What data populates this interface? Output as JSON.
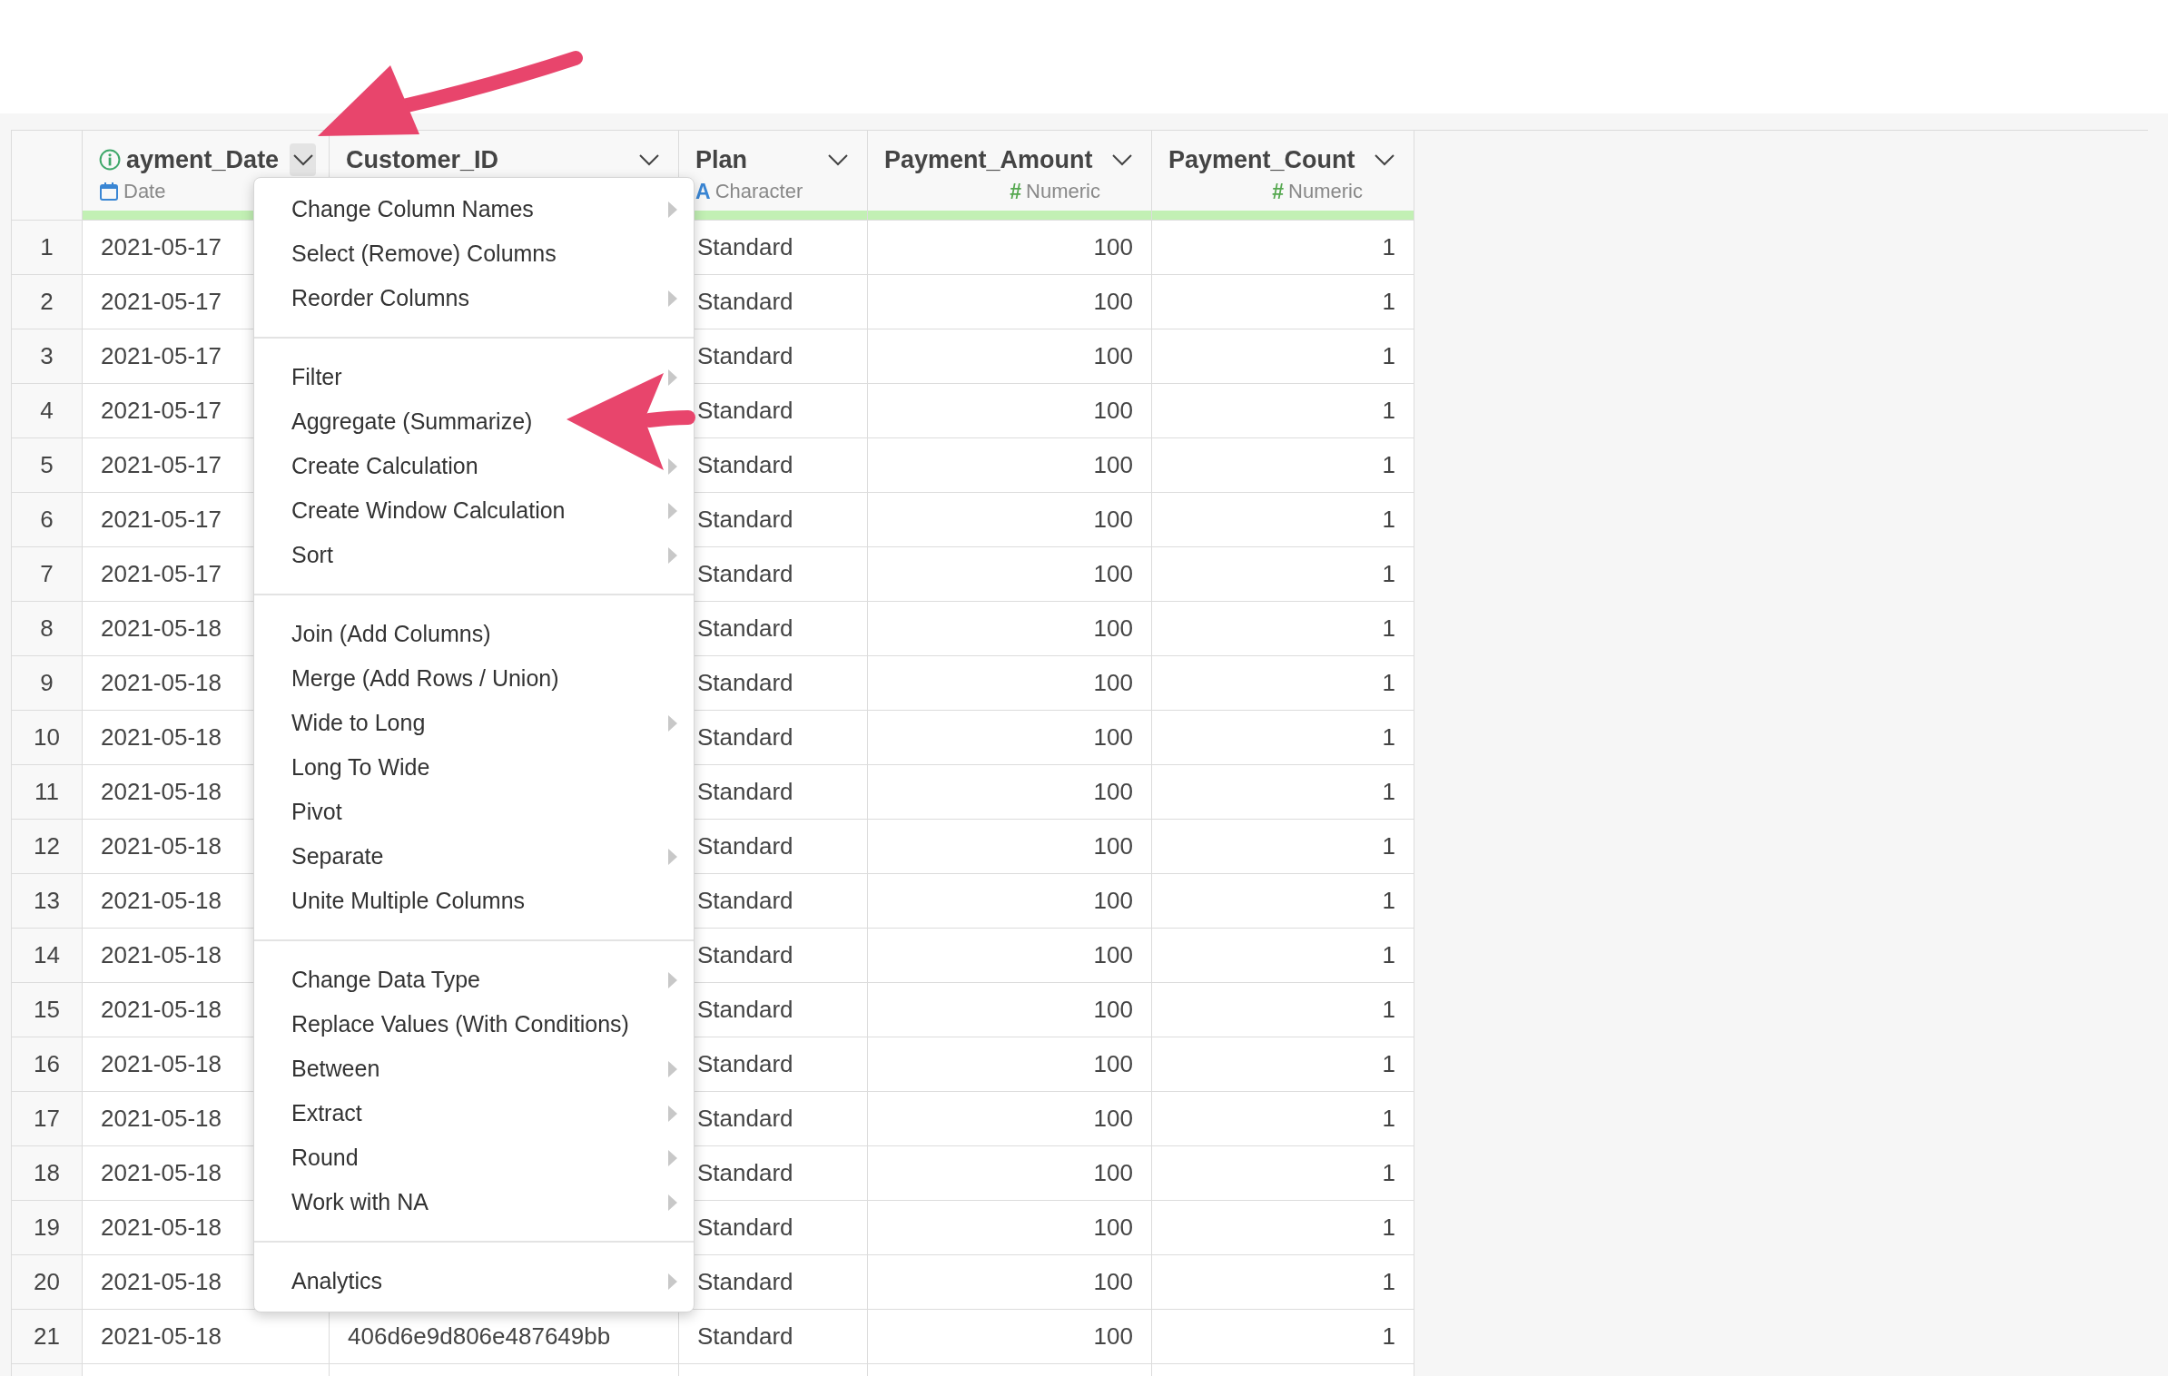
{
  "table": {
    "columns": [
      {
        "title": "ayment_Date",
        "info": true,
        "menu_open": true,
        "type": {
          "kind": "date",
          "label": "Date"
        }
      },
      {
        "title": "Customer_ID",
        "info": false,
        "menu_open": false
      },
      {
        "title": "Plan",
        "info": false,
        "menu_open": false,
        "type": {
          "kind": "character",
          "symbol": "A",
          "label": "Character"
        }
      },
      {
        "title": "Payment_Amount",
        "info": false,
        "menu_open": false,
        "type": {
          "kind": "numeric",
          "symbol": "#",
          "label": "Numeric"
        }
      },
      {
        "title": "Payment_Count",
        "info": false,
        "menu_open": false,
        "type": {
          "kind": "numeric",
          "symbol": "#",
          "label": "Numeric"
        }
      }
    ],
    "rows": [
      {
        "number": "1",
        "payment_date": "2021-05-17",
        "plan": "Standard",
        "payment_amount": "100",
        "payment_count": "1"
      },
      {
        "number": "2",
        "payment_date": "2021-05-17",
        "plan": "Standard",
        "payment_amount": "100",
        "payment_count": "1"
      },
      {
        "number": "3",
        "payment_date": "2021-05-17",
        "plan": "Standard",
        "payment_amount": "100",
        "payment_count": "1"
      },
      {
        "number": "4",
        "payment_date": "2021-05-17",
        "plan": "Standard",
        "payment_amount": "100",
        "payment_count": "1"
      },
      {
        "number": "5",
        "payment_date": "2021-05-17",
        "plan": "Standard",
        "payment_amount": "100",
        "payment_count": "1"
      },
      {
        "number": "6",
        "payment_date": "2021-05-17",
        "plan": "Standard",
        "payment_amount": "100",
        "payment_count": "1"
      },
      {
        "number": "7",
        "payment_date": "2021-05-17",
        "plan": "Standard",
        "payment_amount": "100",
        "payment_count": "1"
      },
      {
        "number": "8",
        "payment_date": "2021-05-18",
        "plan": "Standard",
        "payment_amount": "100",
        "payment_count": "1"
      },
      {
        "number": "9",
        "payment_date": "2021-05-18",
        "plan": "Standard",
        "payment_amount": "100",
        "payment_count": "1"
      },
      {
        "number": "10",
        "payment_date": "2021-05-18",
        "plan": "Standard",
        "payment_amount": "100",
        "payment_count": "1"
      },
      {
        "number": "11",
        "payment_date": "2021-05-18",
        "plan": "Standard",
        "payment_amount": "100",
        "payment_count": "1"
      },
      {
        "number": "12",
        "payment_date": "2021-05-18",
        "plan": "Standard",
        "payment_amount": "100",
        "payment_count": "1"
      },
      {
        "number": "13",
        "payment_date": "2021-05-18",
        "plan": "Standard",
        "payment_amount": "100",
        "payment_count": "1"
      },
      {
        "number": "14",
        "payment_date": "2021-05-18",
        "plan": "Standard",
        "payment_amount": "100",
        "payment_count": "1"
      },
      {
        "number": "15",
        "payment_date": "2021-05-18",
        "plan": "Standard",
        "payment_amount": "100",
        "payment_count": "1"
      },
      {
        "number": "16",
        "payment_date": "2021-05-18",
        "plan": "Standard",
        "payment_amount": "100",
        "payment_count": "1"
      },
      {
        "number": "17",
        "payment_date": "2021-05-18",
        "plan": "Standard",
        "payment_amount": "100",
        "payment_count": "1"
      },
      {
        "number": "18",
        "payment_date": "2021-05-18",
        "plan": "Standard",
        "payment_amount": "100",
        "payment_count": "1"
      },
      {
        "number": "19",
        "payment_date": "2021-05-18",
        "plan": "Standard",
        "payment_amount": "100",
        "payment_count": "1"
      },
      {
        "number": "20",
        "payment_date": "2021-05-18",
        "plan": "Standard",
        "payment_amount": "100",
        "payment_count": "1"
      },
      {
        "number": "21",
        "payment_date": "2021-05-18",
        "customer_id": "406d6e9d806e487649bb",
        "plan": "Standard",
        "payment_amount": "100",
        "payment_count": "1"
      }
    ]
  },
  "column_menu": {
    "groups": [
      [
        {
          "label": "Change Column Names",
          "submenu": true
        },
        {
          "label": "Select (Remove) Columns",
          "submenu": false
        },
        {
          "label": "Reorder Columns",
          "submenu": true
        }
      ],
      [
        {
          "label": "Filter",
          "submenu": true
        },
        {
          "label": "Aggregate (Summarize)",
          "submenu": false
        },
        {
          "label": "Create Calculation",
          "submenu": true
        },
        {
          "label": "Create Window Calculation",
          "submenu": true
        },
        {
          "label": "Sort",
          "submenu": true
        }
      ],
      [
        {
          "label": "Join (Add Columns)",
          "submenu": false
        },
        {
          "label": "Merge (Add Rows / Union)",
          "submenu": false
        },
        {
          "label": "Wide to Long",
          "submenu": true
        },
        {
          "label": "Long To Wide",
          "submenu": false
        },
        {
          "label": "Pivot",
          "submenu": false
        },
        {
          "label": "Separate",
          "submenu": true
        },
        {
          "label": "Unite Multiple Columns",
          "submenu": false
        }
      ],
      [
        {
          "label": "Change Data Type",
          "submenu": true
        },
        {
          "label": "Replace Values (With Conditions)",
          "submenu": false
        },
        {
          "label": "Between",
          "submenu": true
        },
        {
          "label": "Extract",
          "submenu": true
        },
        {
          "label": "Round",
          "submenu": true
        },
        {
          "label": "Work with NA",
          "submenu": true
        }
      ],
      [
        {
          "label": "Analytics",
          "submenu": true
        }
      ]
    ]
  }
}
